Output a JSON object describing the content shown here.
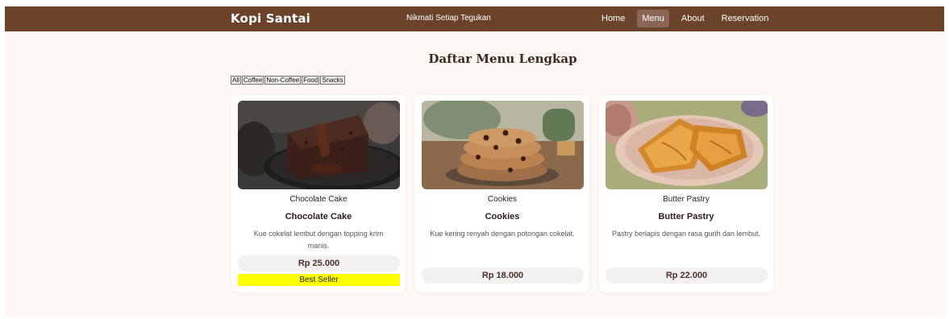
{
  "navbar": {
    "brand": "Kopi Santai",
    "tagline": "Nikmati Setiap Tegukan",
    "links": [
      {
        "label": "Home",
        "active": false
      },
      {
        "label": "Menu",
        "active": true
      },
      {
        "label": "About",
        "active": false
      },
      {
        "label": "Reservation",
        "active": false
      }
    ]
  },
  "menu": {
    "title": "Daftar Menu Lengkap",
    "filters": [
      "All",
      "Coffee",
      "Non-Coffee",
      "Food",
      "Snacks"
    ],
    "items": [
      {
        "caption": "Chocolate Cake",
        "name": "Chocolate Cake",
        "description": "Kue cokelat lembut dengan topping krim manis.",
        "price": "Rp 25.000",
        "badge": "Best Seller"
      },
      {
        "caption": "Cookies",
        "name": "Cookies",
        "description": "Kue kering renyah dengan potongan cokelat.",
        "price": "Rp 18.000"
      },
      {
        "caption": "Butter Pastry",
        "name": "Butter Pastry",
        "description": "Pastry berlapis dengan rasa gurih dan lembut.",
        "price": "Rp 22.000"
      }
    ]
  },
  "colors": {
    "navbar": "#6b432b",
    "page_bg": "#fdf8f4",
    "badge": "#ffff00"
  }
}
